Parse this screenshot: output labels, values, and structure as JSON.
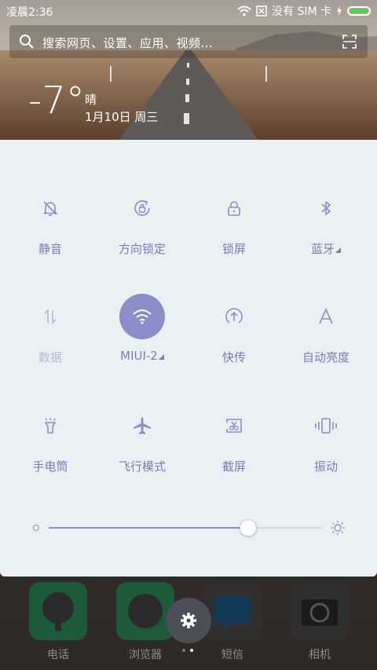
{
  "status_bar": {
    "time": "凌晨2:36",
    "no_sim": "没有 SIM 卡",
    "battery_color": "#3ddc3d"
  },
  "search": {
    "placeholder": "搜索网页、设置、应用、视频..."
  },
  "weather": {
    "temperature": "-7°",
    "condition": "晴",
    "date": "1月10日 周三"
  },
  "quick_settings": {
    "accent": "#8a8ec8",
    "tiles": [
      {
        "label": "静音",
        "icon": "bell-off-icon",
        "active": false
      },
      {
        "label": "方向锁定",
        "icon": "rotation-lock-icon",
        "active": false
      },
      {
        "label": "锁屏",
        "icon": "lock-icon",
        "active": false
      },
      {
        "label": "蓝牙",
        "icon": "bluetooth-icon",
        "active": false
      },
      {
        "label": "数据",
        "icon": "mobile-data-icon",
        "active": false,
        "disabled": true
      },
      {
        "label": "MIUI-2",
        "icon": "wifi-icon",
        "active": true
      },
      {
        "label": "快传",
        "icon": "quick-transfer-icon",
        "active": false
      },
      {
        "label": "自动亮度",
        "icon": "auto-brightness-icon",
        "active": false
      },
      {
        "label": "手电筒",
        "icon": "flashlight-icon",
        "active": false
      },
      {
        "label": "飞行模式",
        "icon": "airplane-icon",
        "active": false
      },
      {
        "label": "截屏",
        "icon": "screenshot-icon",
        "active": false
      },
      {
        "label": "振动",
        "icon": "vibrate-icon",
        "active": false
      }
    ],
    "brightness_level": 0.73
  },
  "dock": {
    "apps": [
      {
        "label": "电话",
        "icon": "phone-app-icon"
      },
      {
        "label": "浏览器",
        "icon": "browser-app-icon"
      },
      {
        "label": "短信",
        "icon": "messages-app-icon"
      },
      {
        "label": "相机",
        "icon": "camera-app-icon"
      }
    ],
    "page_count": 2,
    "current_page": 2
  }
}
